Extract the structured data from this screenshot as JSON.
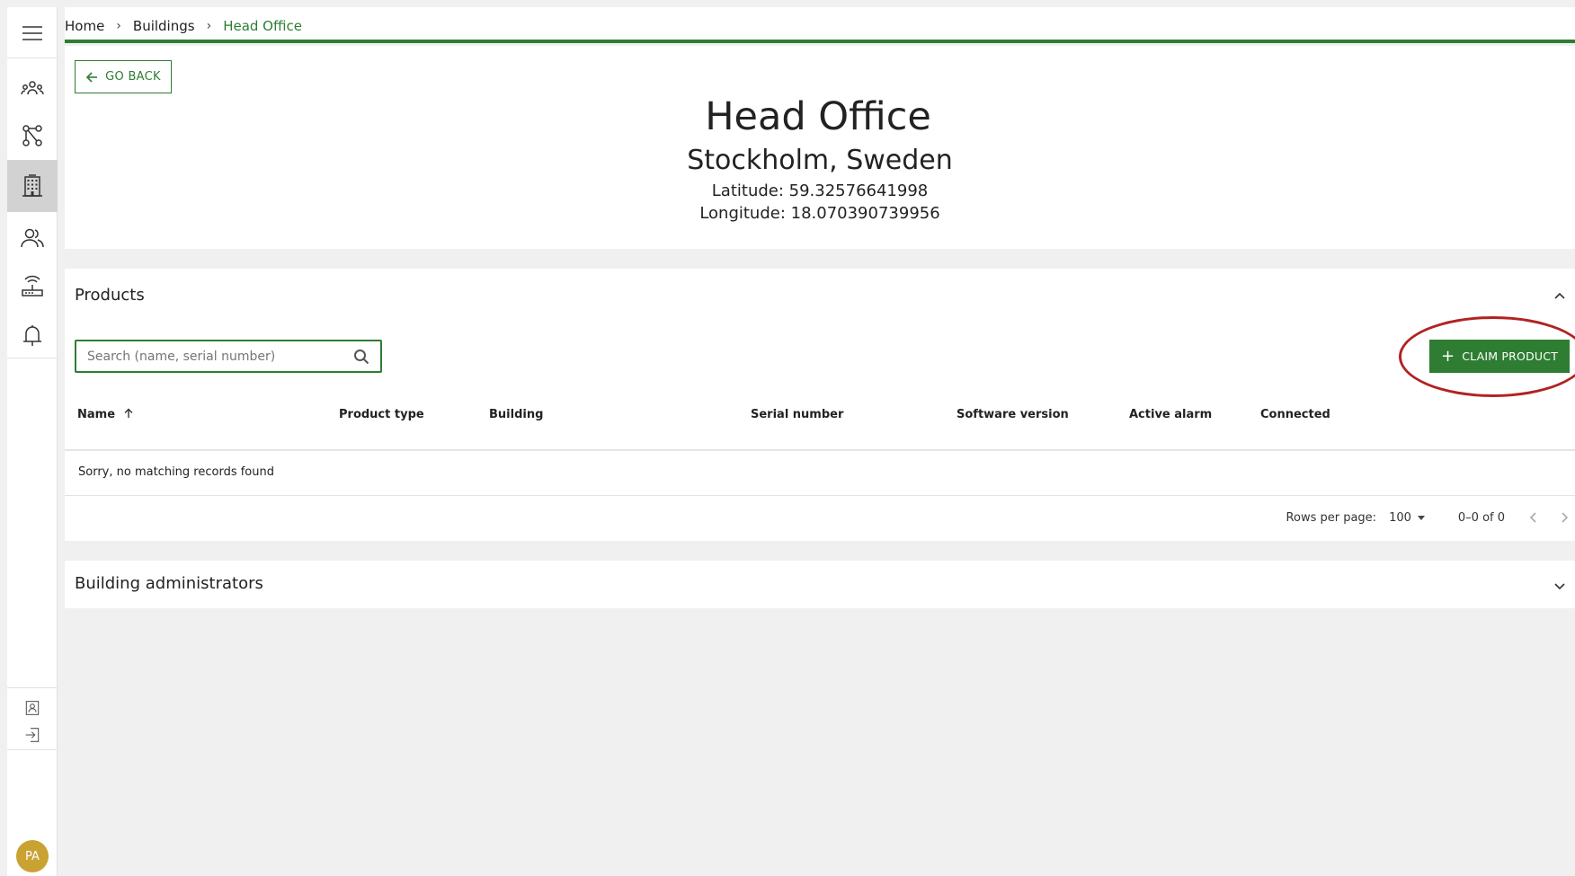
{
  "breadcrumb": {
    "home": "Home",
    "buildings": "Buildings",
    "current": "Head Office",
    "separator": "›"
  },
  "header": {
    "back_label": "GO BACK",
    "title": "Head Office",
    "subtitle": "Stockholm, Sweden",
    "latitude": "Latitude: 59.32576641998",
    "longitude": "Longitude: 18.070390739956"
  },
  "products": {
    "title": "Products",
    "search_placeholder": "Search (name, serial number)",
    "search_value": "",
    "claim_label": "CLAIM PRODUCT",
    "columns": [
      "Name",
      "Product type",
      "Building",
      "Serial number",
      "Software version",
      "Active alarm",
      "Connected"
    ],
    "empty_message": "Sorry, no matching records found",
    "pagination": {
      "rows_label": "Rows per page:",
      "rows_value": "100",
      "range": "0–0 of 0"
    }
  },
  "admins": {
    "title": "Building administrators"
  },
  "user": {
    "initials": "PA"
  },
  "colors": {
    "accent": "#2e7d32",
    "highlight": "#b22222",
    "avatar": "#c9a232"
  },
  "icons": {
    "sidebar": [
      "menu-icon",
      "organization-icon",
      "hierarchy-icon",
      "building-icon",
      "users-icon",
      "gateway-icon",
      "bell-icon",
      "profile-icon",
      "logout-icon"
    ]
  }
}
